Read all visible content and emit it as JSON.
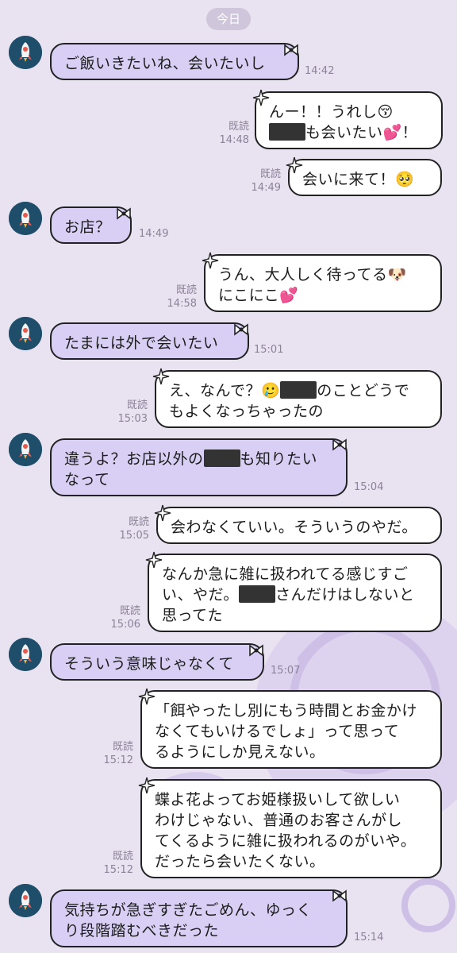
{
  "date_label": "今日",
  "messages": [
    {
      "side": "in",
      "text": "ご飯いきたいね、会いたいし",
      "time": "14:42"
    },
    {
      "side": "out",
      "text": "んー！！うれし😚\n▇▇▇も会いたい💕！",
      "read": "既読",
      "time": "14:48"
    },
    {
      "side": "out",
      "text": "会いに来て！🥺",
      "read": "既読",
      "time": "14:49"
    },
    {
      "side": "in",
      "text": "お店？",
      "time": "14:49"
    },
    {
      "side": "out",
      "text": "うん、大人しく待ってる🐶\nにこにこ💕",
      "read": "既読",
      "time": "14:58"
    },
    {
      "side": "in",
      "text": "たまには外で会いたい",
      "time": "15:01"
    },
    {
      "side": "out",
      "text": "え、なんで？🥲▇▇▇のことどうで\nもよくなっちゃったの",
      "read": "既読",
      "time": "15:03"
    },
    {
      "side": "in",
      "text": "違うよ？お店以外の▇▇▇も知りたい\nなって",
      "time": "15:04"
    },
    {
      "side": "out",
      "text": "会わなくていい。そういうのやだ。",
      "read": "既読",
      "time": "15:05"
    },
    {
      "side": "out",
      "text": "なんか急に雑に扱われてる感じすご\nい、やだ。▇▇▇さんだけはしないと\n思ってた",
      "read": "既読",
      "time": "15:06"
    },
    {
      "side": "in",
      "text": "そういう意味じゃなくて",
      "time": "15:07"
    },
    {
      "side": "out",
      "text": "「餌やったし別にもう時間とお金かけ\nなくてもいけるでしょ」って思って\nるようにしか見えない。",
      "read": "既読",
      "time": "15:12"
    },
    {
      "side": "out",
      "text": "蝶よ花よってお姫様扱いして欲しい\nわけじゃない、普通のお客さんがし\nてくるように雑に扱われるのがいや。\nだったら会いたくない。",
      "read": "既読",
      "time": "15:12"
    },
    {
      "side": "in",
      "text": "気持ちが急ぎすぎたごめん、ゆっく\nり段階踏むべきだった",
      "time": "15:14"
    }
  ]
}
